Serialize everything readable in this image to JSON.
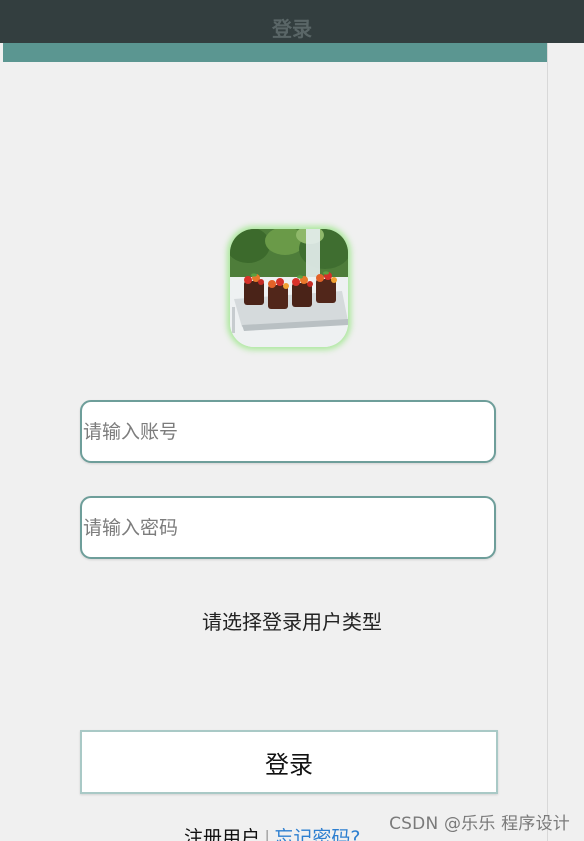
{
  "header": {
    "title": "登录"
  },
  "logo": {
    "icon": "food-dessert-photo-icon"
  },
  "form": {
    "account_placeholder": "请输入账号",
    "password_placeholder": "请输入密码",
    "user_type_prompt": "请选择登录用户类型",
    "login_label": "登录"
  },
  "footer": {
    "register_label": "注册用户",
    "separator": "|",
    "forgot_label": "忘记密码?"
  },
  "watermark": "CSDN @乐乐 程序设计",
  "colors": {
    "header_bg": "#333e3f",
    "header_strip": "#5b9691",
    "field_border": "#6e9e9a",
    "link_blue": "#2d7fd0",
    "logo_glow": "#96e682"
  }
}
